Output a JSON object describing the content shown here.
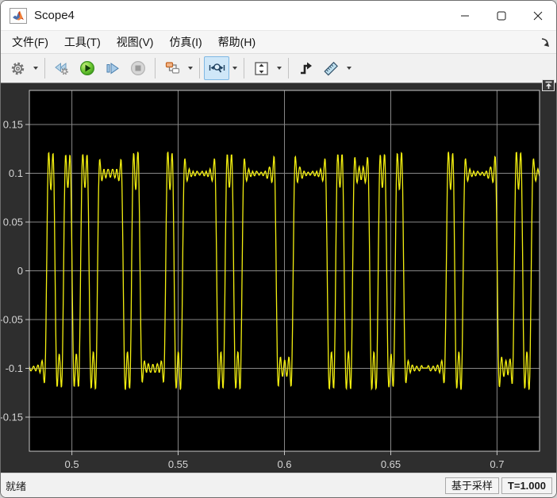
{
  "window": {
    "title": "Scope4"
  },
  "menu": {
    "items": [
      {
        "label": "文件(F)"
      },
      {
        "label": "工具(T)"
      },
      {
        "label": "视图(V)"
      },
      {
        "label": "仿真(I)"
      },
      {
        "label": "帮助(H)"
      }
    ]
  },
  "toolbar": {
    "icons": [
      "settings-gear",
      "step-back",
      "run",
      "step-forward",
      "stop",
      "highlight-simulink-block",
      "zoom-x",
      "fit-to-view",
      "trigger",
      "cursor-measurements"
    ]
  },
  "statusbar": {
    "status": "就绪",
    "mode": "基于采样",
    "time": "T=1.000"
  },
  "chart_data": {
    "type": "line",
    "title": "",
    "xlabel": "",
    "ylabel": "",
    "xlim": [
      0.48,
      0.72
    ],
    "ylim": [
      -0.185,
      0.185
    ],
    "xticks": [
      0.5,
      0.55,
      0.6,
      0.65,
      0.7
    ],
    "xtick_labels": [
      "0.5",
      "0.55",
      "0.6",
      "0.65",
      "0.7"
    ],
    "yticks": [
      0.15,
      0.1,
      0.05,
      0,
      -0.05,
      -0.1,
      -0.15
    ],
    "ytick_labels": [
      "0.15",
      "0.1",
      "0.05",
      "0",
      "-0.05",
      "-0.1",
      "-0.15"
    ],
    "grid": true,
    "legend": null,
    "background": "#000000",
    "grid_color": "#878787",
    "axis_border_color": "#c8c8c8",
    "tick_color": "#d4d4d4",
    "line_color": "#f3ef10",
    "signal": {
      "description": "binary antipodal waveform +/-0.1 through band-limited channel with ringing, peaks ~+/-0.15",
      "amplitude": 0.1,
      "bit_period": 0.004,
      "t0": 0.476,
      "cutoff_frac": 0.19,
      "sample_dt": 0.0002,
      "bits": [
        0,
        0,
        0,
        1,
        0,
        1,
        0,
        1,
        0,
        1,
        1,
        1,
        0,
        1,
        0,
        0,
        0,
        1,
        0,
        1,
        1,
        1,
        1,
        0,
        1,
        0,
        1,
        1,
        1,
        1,
        0,
        0,
        1,
        1,
        1,
        1,
        0,
        1,
        0,
        1,
        1,
        0,
        1,
        0,
        1,
        0,
        0,
        0,
        0,
        0,
        1,
        0,
        1,
        1,
        1,
        1,
        0,
        0,
        1,
        0,
        1,
        1,
        1,
        1
      ]
    }
  }
}
